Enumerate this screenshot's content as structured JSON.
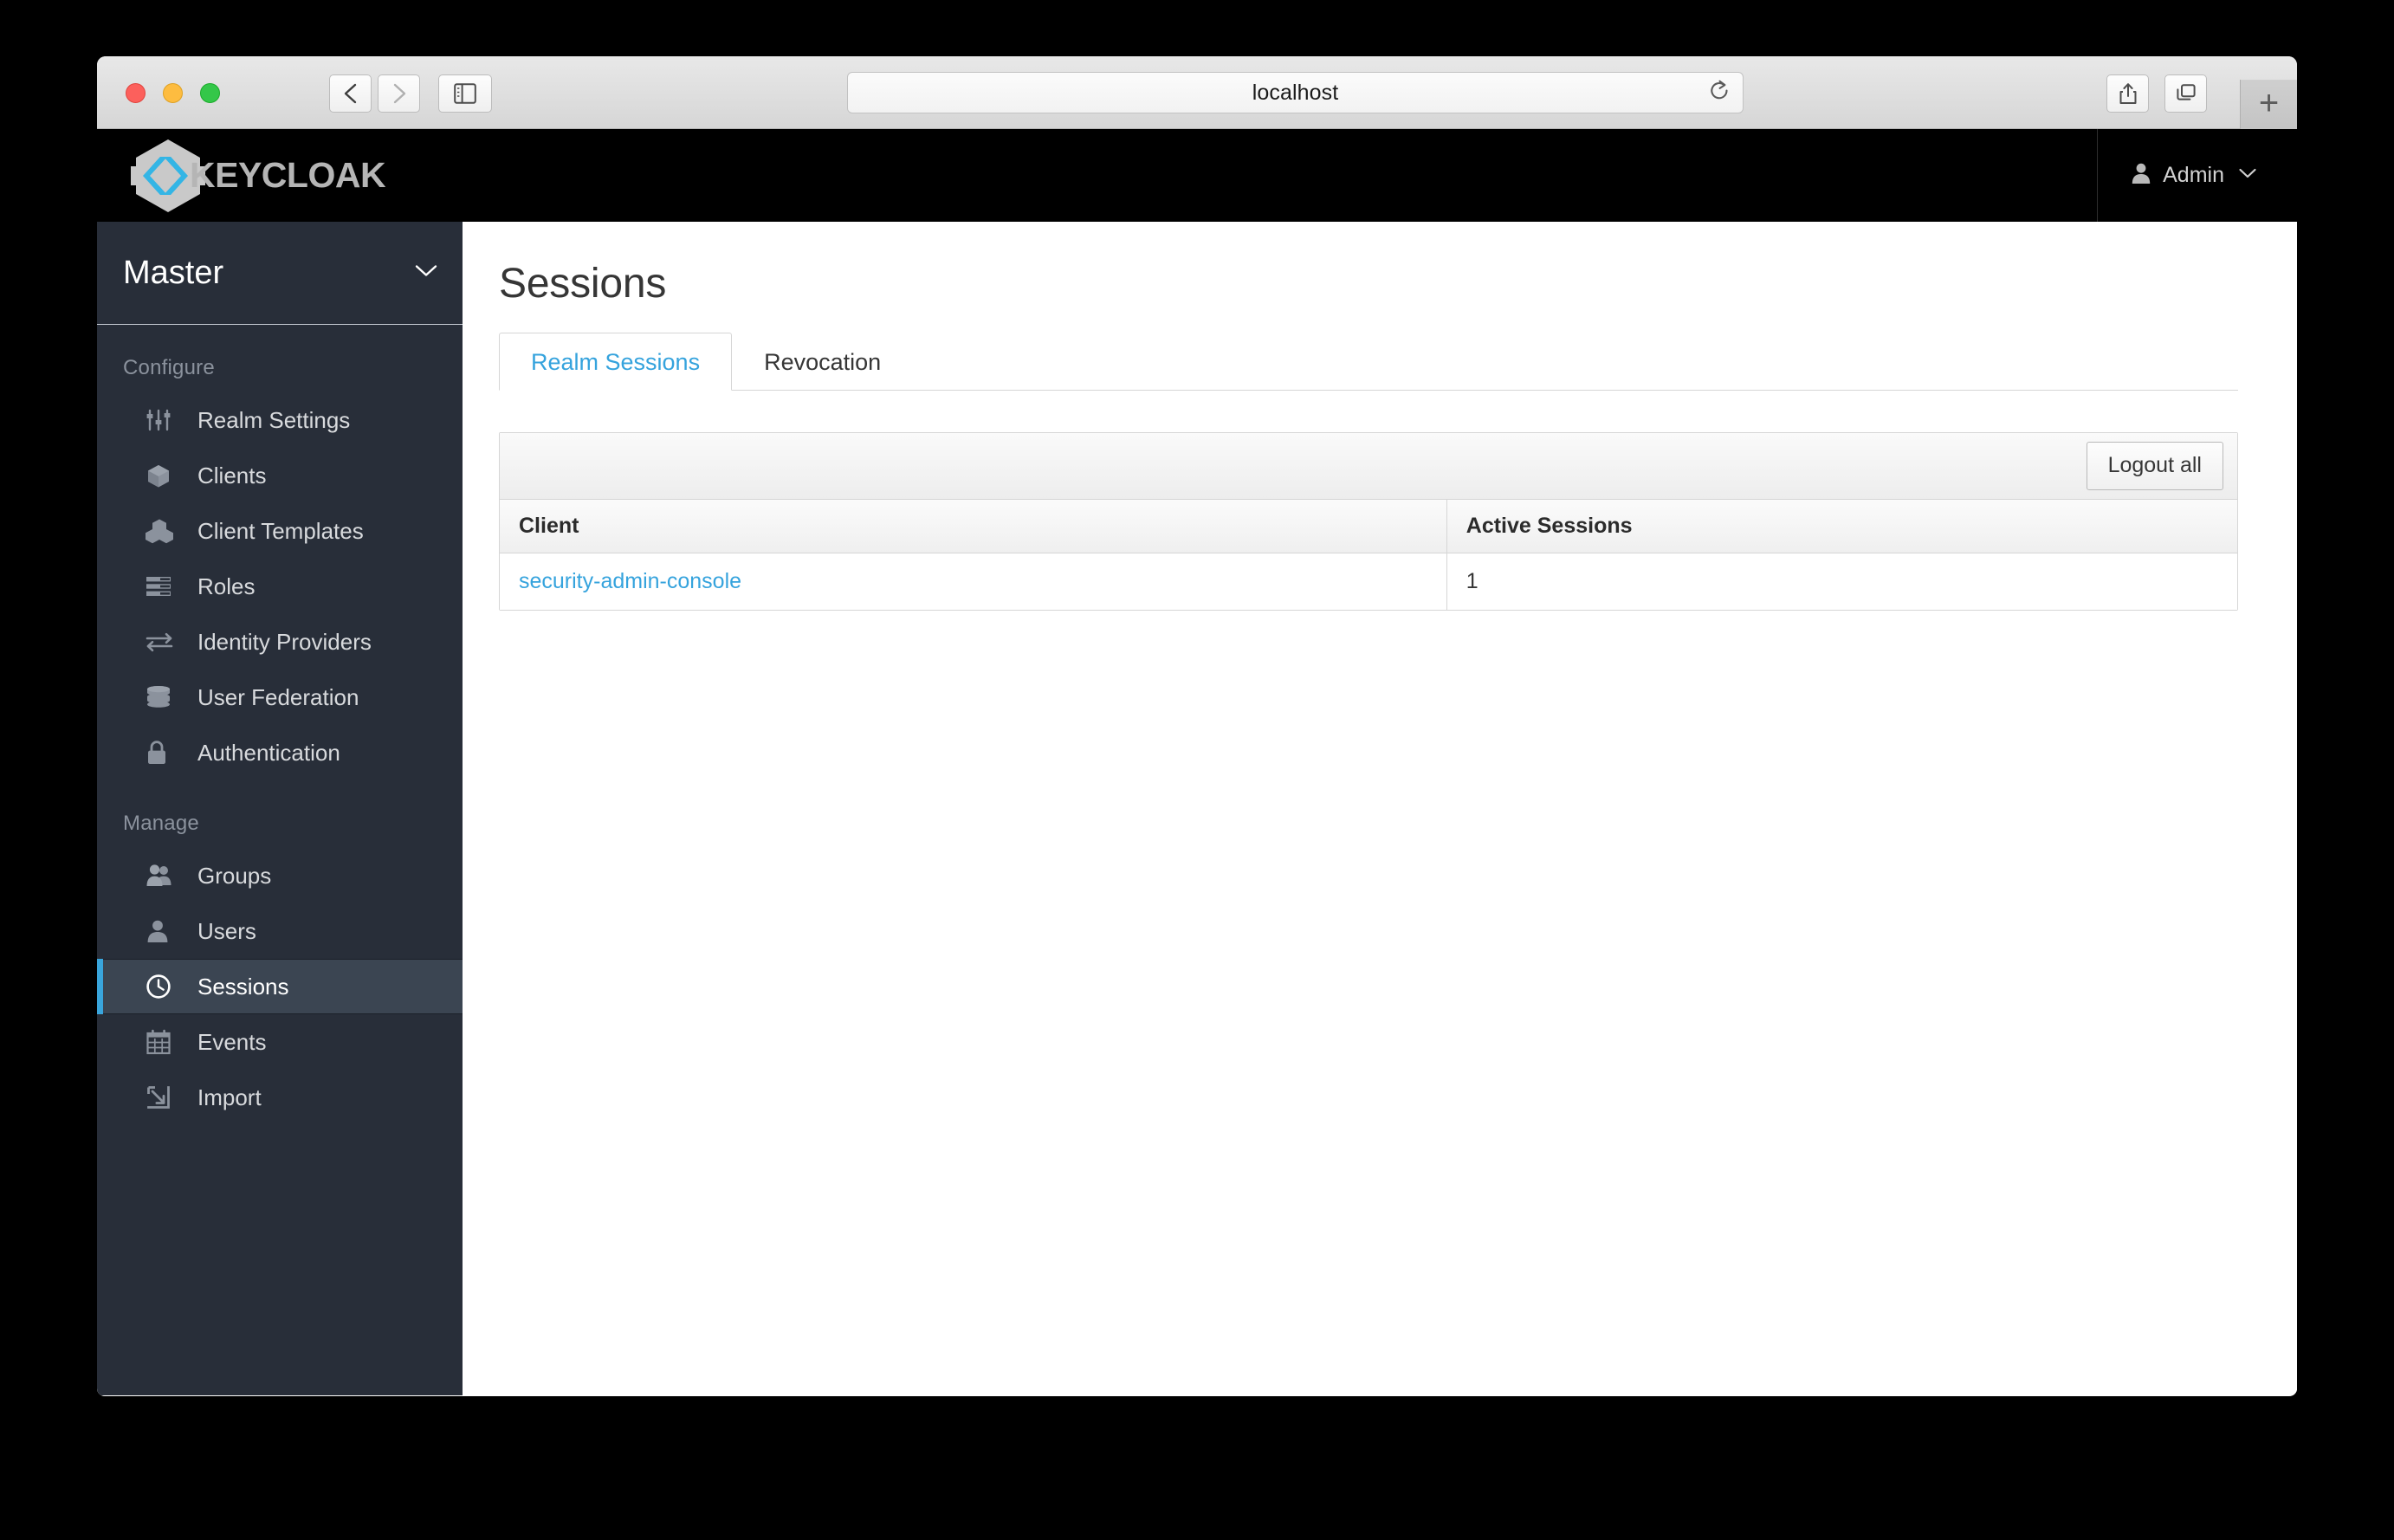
{
  "browser": {
    "url_value": "localhost",
    "traffic_lights": [
      "close",
      "minimize",
      "maximize"
    ],
    "back_icon": "chevron-left-icon",
    "forward_icon": "chevron-right-icon",
    "sidebar_toggle_icon": "sidebar-panel-icon",
    "reload_icon": "reload-icon",
    "share_icon": "share-icon",
    "tab_overview_icon": "tab-overview-icon",
    "new_tab_label": "+"
  },
  "header": {
    "brand_word": "KEYCLOAK",
    "brand_logo_icon": "keycloak-hexagon-logo",
    "user_icon": "user-icon",
    "user_name": "Admin",
    "caret_icon": "chevron-down-icon"
  },
  "sidebar": {
    "realm": {
      "name": "Master",
      "caret_icon": "chevron-down-icon"
    },
    "sections": [
      {
        "label": "Configure",
        "items": [
          {
            "label": "Realm Settings",
            "icon": "sliders-icon",
            "active": false
          },
          {
            "label": "Clients",
            "icon": "cube-icon",
            "active": false
          },
          {
            "label": "Client Templates",
            "icon": "cubes-icon",
            "active": false
          },
          {
            "label": "Roles",
            "icon": "list-bars-icon",
            "active": false
          },
          {
            "label": "Identity Providers",
            "icon": "exchange-arrows-icon",
            "active": false
          },
          {
            "label": "User Federation",
            "icon": "database-icon",
            "active": false
          },
          {
            "label": "Authentication",
            "icon": "lock-icon",
            "active": false
          }
        ]
      },
      {
        "label": "Manage",
        "items": [
          {
            "label": "Groups",
            "icon": "group-users-icon",
            "active": false
          },
          {
            "label": "Users",
            "icon": "user-icon",
            "active": false
          },
          {
            "label": "Sessions",
            "icon": "clock-icon",
            "active": true
          },
          {
            "label": "Events",
            "icon": "calendar-icon",
            "active": false
          },
          {
            "label": "Import",
            "icon": "import-arrow-icon",
            "active": false
          }
        ]
      }
    ],
    "accent_color": "#39a5dc",
    "background_color": "#282e39",
    "active_background_color": "#3b4552"
  },
  "main": {
    "page_title": "Sessions",
    "tabs": [
      {
        "label": "Realm Sessions",
        "active": true
      },
      {
        "label": "Revocation",
        "active": false
      }
    ],
    "toolbar": {
      "logout_all_label": "Logout all"
    },
    "table": {
      "columns": [
        "Client",
        "Active Sessions"
      ],
      "rows": [
        {
          "client": "security-admin-console",
          "active_sessions": "1"
        }
      ]
    },
    "link_color": "#35a3dd"
  }
}
